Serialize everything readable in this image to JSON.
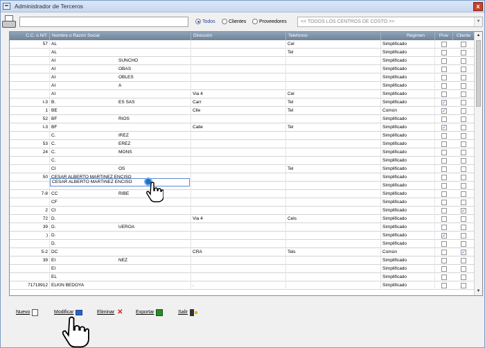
{
  "window": {
    "title": "Administrador de Terceros",
    "close_label": "x"
  },
  "filters": {
    "search_value": "",
    "radios": [
      {
        "label": "Todos",
        "selected": true
      },
      {
        "label": "Clientes",
        "selected": false
      },
      {
        "label": "Proveedores",
        "selected": false
      }
    ],
    "cost_center": "<< TODOS LOS CENTROS DE COSTO >>"
  },
  "table": {
    "columns": [
      "C.C. o NIT",
      "Nombre o Razón Social",
      "Dirección",
      "Telefonos",
      "Régimen",
      "Prov",
      "Cliente"
    ],
    "rows": [
      {
        "nit": "57",
        "nombre": "AL",
        "nombre2": "",
        "dir": "",
        "tel": "Cel",
        "regimen": "Simplificado",
        "prov": false,
        "cli": false
      },
      {
        "nit": "",
        "nombre": "AL",
        "nombre2": "",
        "dir": "",
        "tel": "Tel",
        "regimen": "Simplificado",
        "prov": false,
        "cli": false
      },
      {
        "nit": "",
        "nombre": "AI",
        "nombre2": "SUNCHO",
        "dir": "",
        "tel": "",
        "regimen": "Simplificado",
        "prov": false,
        "cli": false
      },
      {
        "nit": "",
        "nombre": "AI",
        "nombre2": "OBAS",
        "dir": "",
        "tel": "",
        "regimen": "Simplificado",
        "prov": false,
        "cli": false
      },
      {
        "nit": "",
        "nombre": "AI",
        "nombre2": "OBLES",
        "dir": "",
        "tel": "",
        "regimen": "Simplificado",
        "prov": false,
        "cli": false
      },
      {
        "nit": "",
        "nombre": "AI",
        "nombre2": "A",
        "dir": "",
        "tel": "",
        "regimen": "Simplificado",
        "prov": false,
        "cli": false
      },
      {
        "nit": "",
        "nombre": "AI",
        "nombre2": "",
        "dir": "Via 4",
        "tel": "Cel",
        "regimen": "Simplificado",
        "prov": false,
        "cli": false
      },
      {
        "nit": "l-3",
        "nombre": "B.",
        "nombre2": "ES SAS",
        "dir": "Carr",
        "tel": "Tel",
        "regimen": "Simplificado",
        "prov": true,
        "cli": false
      },
      {
        "nit": "1",
        "nombre": "BE",
        "nombre2": "",
        "dir": "Clle",
        "tel": "Tel",
        "regimen": "Común",
        "prov": true,
        "cli": false
      },
      {
        "nit": "52",
        "nombre": "BF",
        "nombre2": "RIOS",
        "dir": "",
        "tel": "",
        "regimen": "Simplificado",
        "prov": false,
        "cli": false
      },
      {
        "nit": "l-3",
        "nombre": "BF",
        "nombre2": "",
        "dir": "Calle",
        "tel": "Tel",
        "regimen": "Simplificado",
        "prov": true,
        "cli": false
      },
      {
        "nit": "",
        "nombre": "C.",
        "nombre2": "IREZ",
        "dir": "",
        "tel": "",
        "regimen": "Simplificado",
        "prov": false,
        "cli": false
      },
      {
        "nit": "53",
        "nombre": "C.",
        "nombre2": "EREZ",
        "dir": "",
        "tel": "",
        "regimen": "Simplificado",
        "prov": false,
        "cli": false
      },
      {
        "nit": "24",
        "nombre": "C.",
        "nombre2": "MONS",
        "dir": "",
        "tel": "",
        "regimen": "Simplificado",
        "prov": false,
        "cli": false
      },
      {
        "nit": "",
        "nombre": "C.",
        "nombre2": "",
        "dir": "",
        "tel": "",
        "regimen": "Simplificado",
        "prov": false,
        "cli": false
      },
      {
        "nit": "",
        "nombre": "CI",
        "nombre2": "OS",
        "dir": "",
        "tel": "Tel",
        "regimen": "Simplificado",
        "prov": false,
        "cli": false
      },
      {
        "nit": "50",
        "nombre": "CESAR ALBERTO MARTINEZ ENCISO",
        "nombre2": "",
        "dir": "",
        "tel": "",
        "regimen": "Simplificado",
        "prov": false,
        "cli": false,
        "selected": true
      },
      {
        "nit": "",
        "nombre": "CE",
        "nombre2": "TA",
        "dir": "",
        "tel": "",
        "regimen": "Simplificado",
        "prov": false,
        "cli": false
      },
      {
        "nit": "7-8",
        "nombre": "CC",
        "nombre2": "RIBE",
        "dir": "",
        "tel": "",
        "regimen": "Simplificado",
        "prov": false,
        "cli": false
      },
      {
        "nit": "",
        "nombre": "CF",
        "nombre2": "",
        "dir": "",
        "tel": "",
        "regimen": "Simplificado",
        "prov": false,
        "cli": false
      },
      {
        "nit": "2",
        "nombre": "CI",
        "nombre2": "",
        "dir": "",
        "tel": "",
        "regimen": "Simplificado",
        "prov": false,
        "cli": true
      },
      {
        "nit": "72",
        "nombre": "D.",
        "nombre2": "",
        "dir": "Via 4",
        "tel": "Cels",
        "regimen": "Simplificado",
        "prov": false,
        "cli": false
      },
      {
        "nit": "39",
        "nombre": "D.",
        "nombre2": "UEROA",
        "dir": "",
        "tel": "",
        "regimen": "Simplificado",
        "prov": false,
        "cli": false
      },
      {
        "nit": ")",
        "nombre": "D.",
        "nombre2": "",
        "dir": "",
        "tel": "",
        "regimen": "Simplificado",
        "prov": true,
        "cli": false
      },
      {
        "nit": "",
        "nombre": "D.",
        "nombre2": "",
        "dir": "",
        "tel": "",
        "regimen": "Simplificado",
        "prov": false,
        "cli": false
      },
      {
        "nit": "5-2",
        "nombre": "DC",
        "nombre2": "",
        "dir": "CRA",
        "tel": "Tels",
        "regimen": "Común",
        "prov": false,
        "cli": true
      },
      {
        "nit": "39",
        "nombre": "EI",
        "nombre2": "NEZ",
        "dir": "",
        "tel": "",
        "regimen": "Simplificado",
        "prov": false,
        "cli": false
      },
      {
        "nit": "",
        "nombre": "EI",
        "nombre2": "",
        "dir": "",
        "tel": "",
        "regimen": "Simplificado",
        "prov": false,
        "cli": false
      },
      {
        "nit": "",
        "nombre": "EL",
        "nombre2": "",
        "dir": "",
        "tel": "",
        "regimen": "Simplificado",
        "prov": false,
        "cli": false
      },
      {
        "nit": "71719912",
        "nombre": "ELKIN BEDOYA",
        "nombre2": "",
        "dir": ".",
        "tel": "",
        "regimen": "Simplificado",
        "prov": false,
        "cli": false
      }
    ]
  },
  "bottom_buttons": [
    {
      "label": "Nuevo",
      "icon": "new-doc-icon"
    },
    {
      "label": "Modificar",
      "icon": "edit-icon"
    },
    {
      "label": "Eliminar",
      "icon": "delete-icon"
    },
    {
      "label": "Exportar",
      "icon": "excel-icon"
    },
    {
      "label": "Salir",
      "icon": "exit-icon"
    }
  ]
}
